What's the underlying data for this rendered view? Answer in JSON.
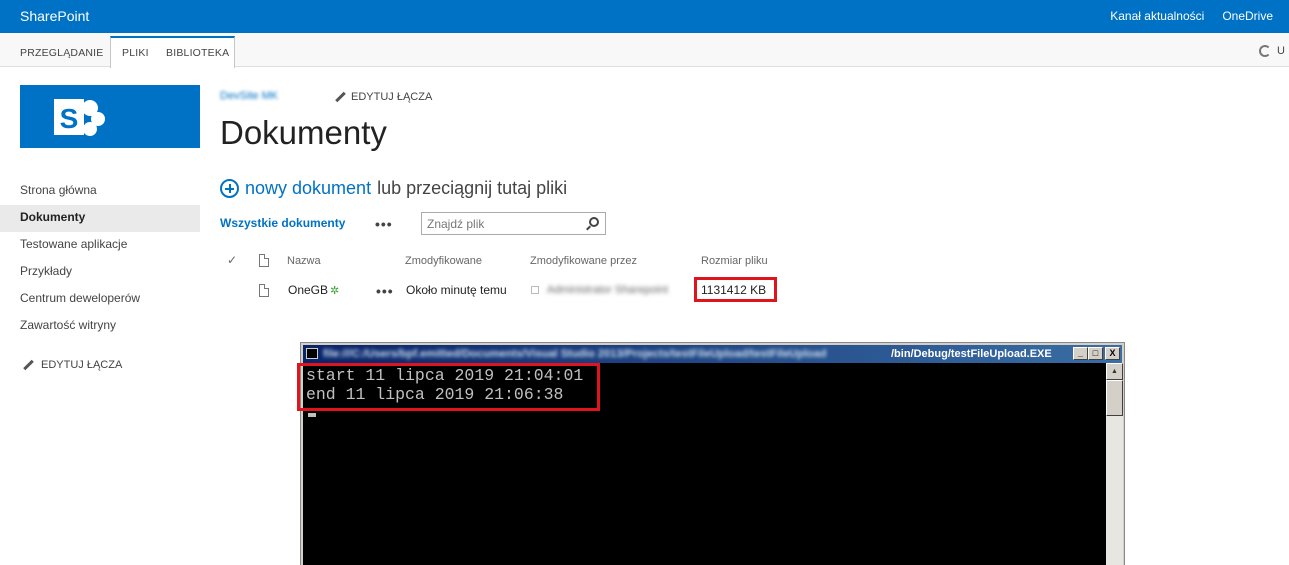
{
  "suitebar": {
    "brand": "SharePoint",
    "links": [
      "Kanał aktualności",
      "OneDrive"
    ]
  },
  "ribbon": {
    "tabs": [
      "PRZEGLĄDANIE",
      "PLIKI",
      "BIBLIOTEKA"
    ],
    "sync_label": "U"
  },
  "header": {
    "site_name": "DevSite MK",
    "edit_links": "EDYTUJ ŁĄCZA",
    "title": "Dokumenty"
  },
  "nav": {
    "items": [
      "Strona główna",
      "Dokumenty",
      "Testowane aplikacje",
      "Przykłady",
      "Centrum deweloperów",
      "Zawartość witryny"
    ],
    "active": "Dokumenty",
    "edit_links": "EDYTUJ ŁĄCZA"
  },
  "newdoc": {
    "link": "nowy dokument",
    "rest": "lub przeciągnij tutaj pliki"
  },
  "views": {
    "all_docs": "Wszystkie dokumenty",
    "more": "•••",
    "search_placeholder": "Znajdź plik"
  },
  "list": {
    "columns": {
      "check": "✓",
      "name": "Nazwa",
      "modified": "Zmodyfikowane",
      "modified_by": "Zmodyfikowane przez",
      "size": "Rozmiar pliku"
    },
    "rows": [
      {
        "name": "OneGB",
        "new_marker": "✲",
        "more": "•••",
        "modified": "Około minutę temu",
        "modified_by": "Administrator Sharepoint",
        "size": "1131412 KB"
      }
    ]
  },
  "console": {
    "title_blurred": "file:///C:/Users/bpf.emitted/Documents/Visual Studio 2013/Projects/testFileUpload/testFileUpload",
    "title_visible": "/bin/Debug/testFileUpload.EXE",
    "lines": [
      "start 11 lipca 2019 21:04:01",
      "end 11 lipca 2019 21:06:38"
    ],
    "buttons": [
      "_",
      "□",
      "X"
    ]
  },
  "colors": {
    "suite_blue": "#0072c6",
    "highlight_red": "#e0141c",
    "console_bg": "#000000"
  }
}
